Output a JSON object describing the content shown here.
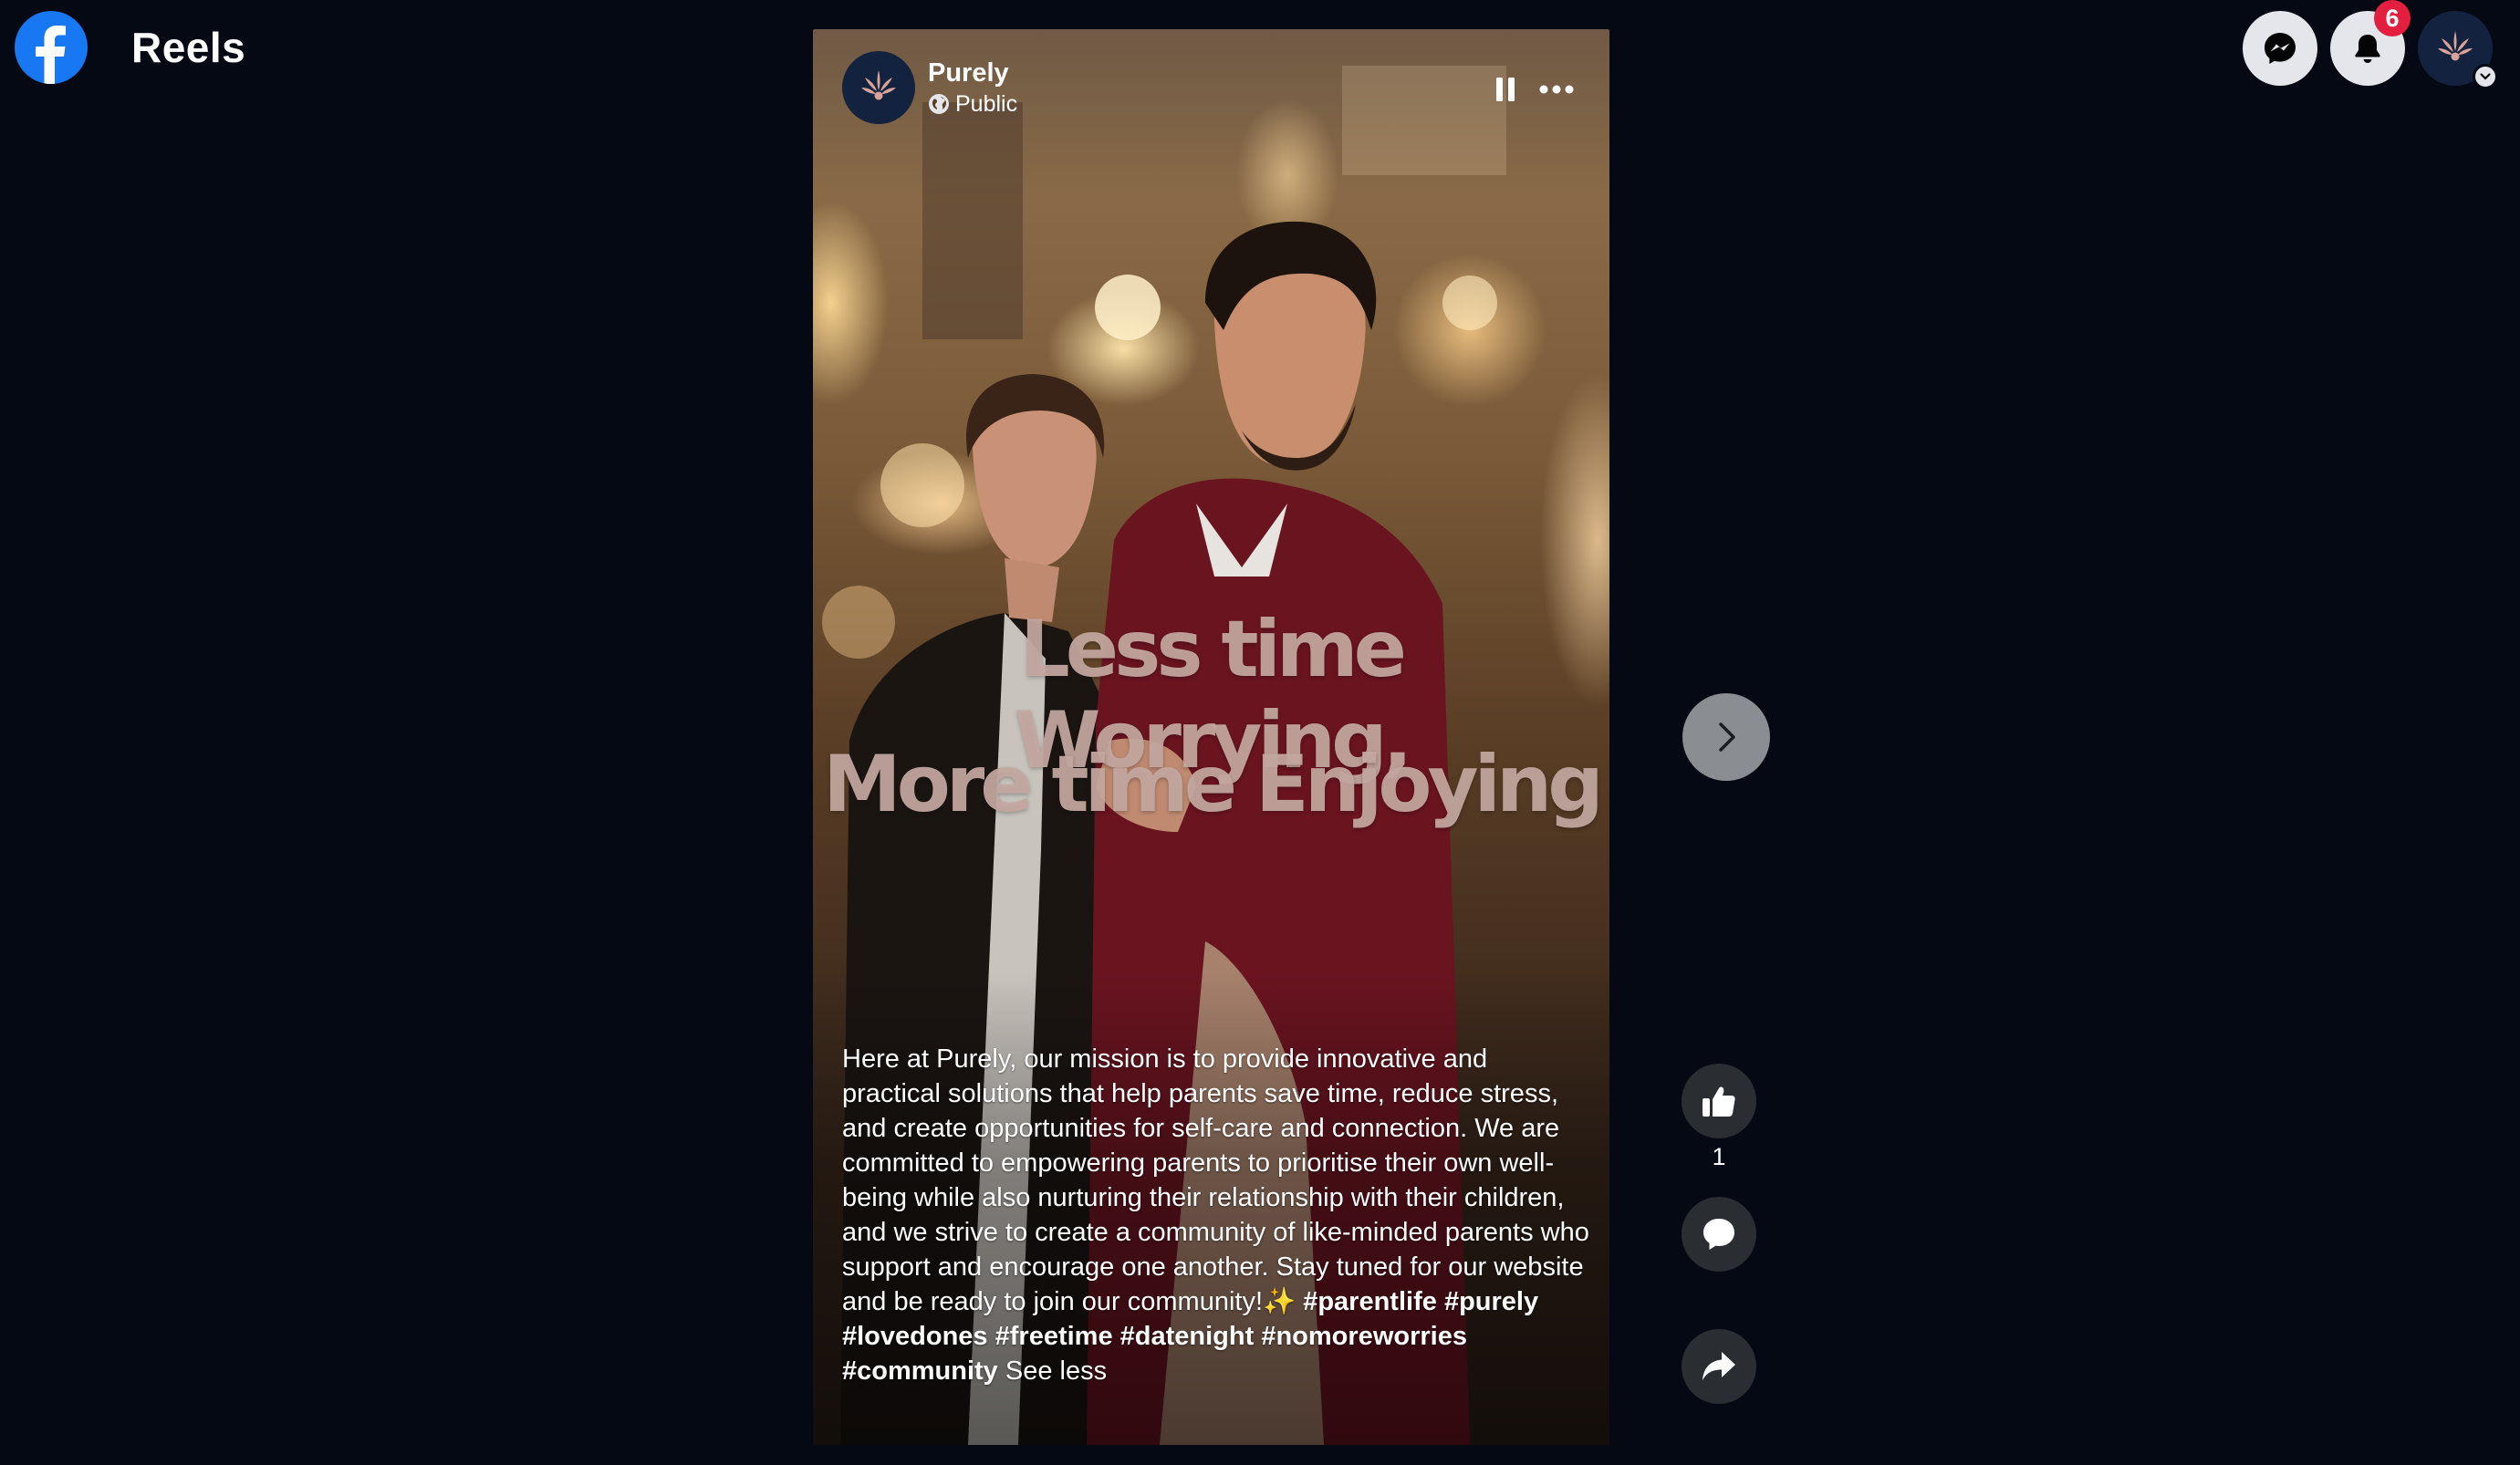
{
  "header": {
    "app_logo_icon": "facebook-icon",
    "title": "Reels",
    "notification_count": "6",
    "messenger_icon": "messenger-icon",
    "notifications_icon": "bell-icon",
    "account_icon": "account-avatar",
    "brand_color": "#1877f2",
    "badge_color": "#e41e3f"
  },
  "reel": {
    "page_name": "Purely",
    "privacy": "Public",
    "privacy_icon": "globe-icon",
    "overlay_line1": "Less time Worrying,",
    "overlay_line2": "More time Enjoying",
    "caption": {
      "text": "Here at Purely, our mission is to provide innovative and practical solutions that help parents save time, reduce stress, and create opportunities for self-care and connection. We are committed to empowering parents to prioritise their own well-being while also nurturing their relationship with their children, and we strive to create a community of like-minded parents who support and encourage one another. Stay tuned for our website and be ready to join our community!",
      "emoji": "✨",
      "hashtags": [
        "#parentlife",
        "#purely",
        "#lovedones",
        "#freetime",
        "#datenight",
        "#nomoreworries",
        "#community"
      ],
      "see_less": "See less"
    }
  },
  "actions": {
    "like_count": "1",
    "like_icon": "thumbs-up-icon",
    "comment_icon": "comment-icon",
    "share_icon": "share-icon",
    "next_icon": "chevron-right-icon"
  }
}
